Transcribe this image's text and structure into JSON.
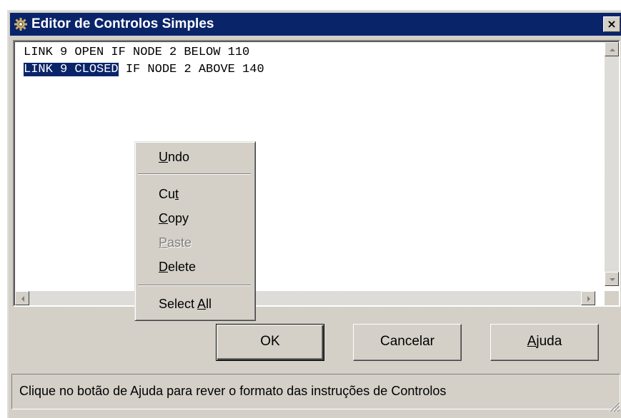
{
  "window": {
    "title": "Editor de Controlos Simples",
    "close_label": "×"
  },
  "editor": {
    "lines": [
      {
        "selected": "",
        "text": "LINK 9 OPEN IF NODE 2 BELOW 110"
      },
      {
        "selected": "LINK 9 CLOSED",
        "text": " IF NODE 2 ABOVE 140"
      }
    ]
  },
  "context_menu": {
    "items": [
      {
        "pre": "",
        "key": "U",
        "post": "ndo",
        "enabled": true
      },
      {
        "pre": "Cu",
        "key": "t",
        "post": "",
        "enabled": true
      },
      {
        "pre": "",
        "key": "C",
        "post": "opy",
        "enabled": true
      },
      {
        "pre": "",
        "key": "P",
        "post": "aste",
        "enabled": false
      },
      {
        "pre": "",
        "key": "D",
        "post": "elete",
        "enabled": true
      },
      {
        "pre": "Select ",
        "key": "A",
        "post": "ll",
        "enabled": true
      }
    ]
  },
  "buttons": {
    "ok_label": "OK",
    "cancel_label": "Cancelar",
    "help_pre": "",
    "help_key": "A",
    "help_post": "juda"
  },
  "status": {
    "text": "Clique no botão de Ajuda para rever o formato das instruções de Controlos"
  },
  "colors": {
    "titlebar": "#0a246a",
    "face": "#d4d0c8",
    "selection": "#0a246a"
  },
  "icons": {
    "app": "gear-icon",
    "close": "close-icon",
    "scroll_up": "arrow-up-icon",
    "scroll_down": "arrow-down-icon",
    "scroll_left": "arrow-left-icon",
    "scroll_right": "arrow-right-icon",
    "resize": "resize-grip-icon"
  }
}
